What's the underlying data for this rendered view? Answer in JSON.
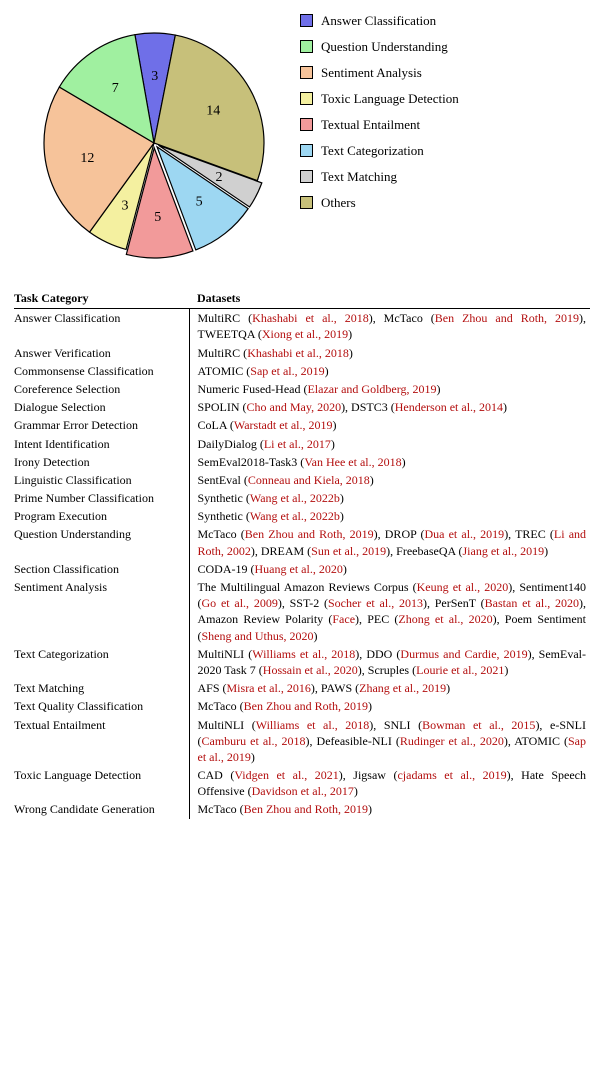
{
  "chart_data": {
    "type": "pie",
    "title": "",
    "series": [
      {
        "name": "Answer Classification",
        "value": 3,
        "color": "#6f6fe8"
      },
      {
        "name": "Question Understanding",
        "value": 7,
        "color": "#a0f0a0"
      },
      {
        "name": "Sentiment Analysis",
        "value": 12,
        "color": "#f6c39a"
      },
      {
        "name": "Toxic Language Detection",
        "value": 3,
        "color": "#f4f0a0"
      },
      {
        "name": "Textual Entailment",
        "value": 5,
        "color": "#f29a9a"
      },
      {
        "name": "Text Categorization",
        "value": 5,
        "color": "#9dd7f2"
      },
      {
        "name": "Text Matching",
        "value": 2,
        "color": "#d0d0d0"
      },
      {
        "name": "Others",
        "value": 14,
        "color": "#c7c07a"
      }
    ]
  },
  "table": {
    "headers": {
      "col_a": "Task Category",
      "col_b": "Datasets"
    },
    "rows": [
      {
        "category": "Answer Classification",
        "datasets": "MultiRC (<span class=cite>Khashabi et al., 2018</span>), McTaco (<span class=cite>Ben Zhou and Roth, 2019</span>), TWEETQA (<span class=cite>Xiong et al., 2019</span>)"
      },
      {
        "category": "Answer Verification",
        "datasets": "MultiRC (<span class=cite>Khashabi et al., 2018</span>)"
      },
      {
        "category": "Commonsense Classification",
        "datasets": "ATOMIC (<span class=cite>Sap et al., 2019</span>)"
      },
      {
        "category": "Coreference Selection",
        "datasets": "Numeric Fused-Head (<span class=cite>Elazar and Goldberg, 2019</span>)"
      },
      {
        "category": "Dialogue Selection",
        "datasets": "SPOLIN (<span class=cite>Cho and May, 2020</span>), DSTC3 (<span class=cite>Henderson et al., 2014</span>)"
      },
      {
        "category": "Grammar Error Detection",
        "datasets": "CoLA (<span class=cite>Warstadt et al., 2019</span>)"
      },
      {
        "category": "Intent Identification",
        "datasets": "DailyDialog (<span class=cite>Li et al., 2017</span>)"
      },
      {
        "category": "Irony Detection",
        "datasets": "SemEval2018-Task3 (<span class=cite>Van Hee et al., 2018</span>)"
      },
      {
        "category": "Linguistic Classification",
        "datasets": "SentEval (<span class=cite>Conneau and Kiela, 2018</span>)"
      },
      {
        "category": "Prime Number Classification",
        "datasets": "Synthetic (<span class=cite>Wang et al., 2022b</span>)"
      },
      {
        "category": "Program Execution",
        "datasets": "Synthetic (<span class=cite>Wang et al., 2022b</span>)"
      },
      {
        "category": "Question Understanding",
        "datasets": "McTaco (<span class=cite>Ben Zhou and Roth, 2019</span>), DROP (<span class=cite>Dua et al., 2019</span>), TREC (<span class=cite>Li and Roth, 2002</span>), DREAM (<span class=cite>Sun et al., 2019</span>), FreebaseQA (<span class=cite>Jiang et al., 2019</span>)"
      },
      {
        "category": "Section Classification",
        "datasets": "CODA-19 (<span class=cite>Huang et al., 2020</span>)"
      },
      {
        "category": "Sentiment Analysis",
        "datasets": "The Multilingual Amazon Reviews Corpus (<span class=cite>Keung et al., 2020</span>), Sentiment140 (<span class=cite>Go et al., 2009</span>), SST-2 (<span class=cite>Socher et al., 2013</span>), PerSenT (<span class=cite>Bastan et al., 2020</span>), Amazon Review Polarity (<span class=cite>Face</span>), PEC (<span class=cite>Zhong et al., 2020</span>), Poem Sentiment (<span class=cite>Sheng and Uthus, 2020</span>)"
      },
      {
        "category": "Text Categorization",
        "datasets": "MultiNLI (<span class=cite>Williams et al., 2018</span>), DDO (<span class=cite>Durmus and Cardie, 2019</span>), SemEval-2020 Task 7 (<span class=cite>Hossain et al., 2020</span>), Scruples (<span class=cite>Lourie et al., 2021</span>)"
      },
      {
        "category": "Text Matching",
        "datasets": "AFS (<span class=cite>Misra et al., 2016</span>), PAWS (<span class=cite>Zhang et al., 2019</span>)"
      },
      {
        "category": "Text Quality Classification",
        "datasets": "McTaco (<span class=cite>Ben Zhou and Roth, 2019</span>)"
      },
      {
        "category": "Textual Entailment",
        "datasets": "MultiNLI (<span class=cite>Williams et al., 2018</span>), SNLI (<span class=cite>Bowman et al., 2015</span>), e-SNLI (<span class=cite>Camburu et al., 2018</span>), Defeasible-NLI (<span class=cite>Rudinger et al., 2020</span>), ATOMIC (<span class=cite>Sap et al., 2019</span>)"
      },
      {
        "category": "Toxic Language Detection",
        "datasets": "CAD (<span class=cite>Vidgen et al., 2021</span>), Jigsaw (<span class=cite>cjadams et al., 2019</span>), Hate Speech Offensive (<span class=cite>Davidson et al., 2017</span>)"
      },
      {
        "category": "Wrong Candidate Generation",
        "datasets": "McTaco (<span class=cite>Ben Zhou and Roth, 2019</span>)"
      }
    ]
  }
}
